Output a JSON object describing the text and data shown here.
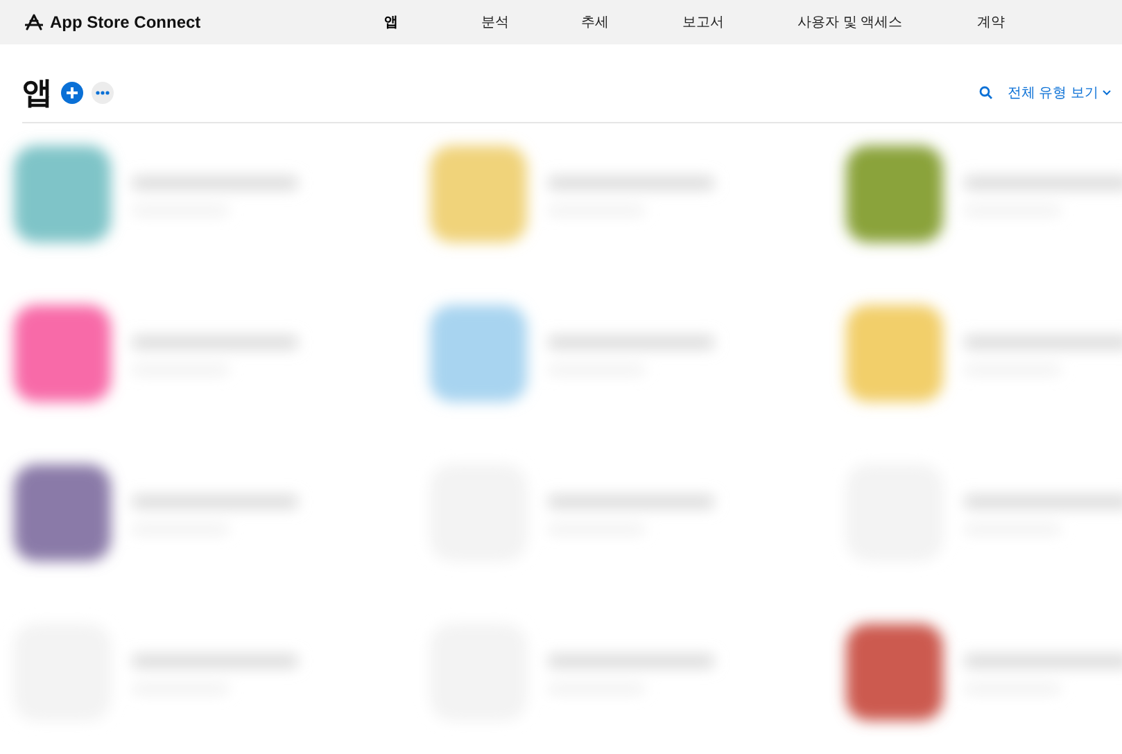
{
  "top_bar": {
    "brand": "App Store Connect",
    "nav": [
      {
        "label": "앱",
        "selected": true
      },
      {
        "label": "분석",
        "selected": false
      },
      {
        "label": "추세",
        "selected": false
      },
      {
        "label": "보고서",
        "selected": false
      },
      {
        "label": "사용자 및 액세스",
        "selected": false
      },
      {
        "label": "계약",
        "selected": false
      }
    ]
  },
  "header": {
    "title": "앱",
    "filter": "전체 유형 보기"
  }
}
